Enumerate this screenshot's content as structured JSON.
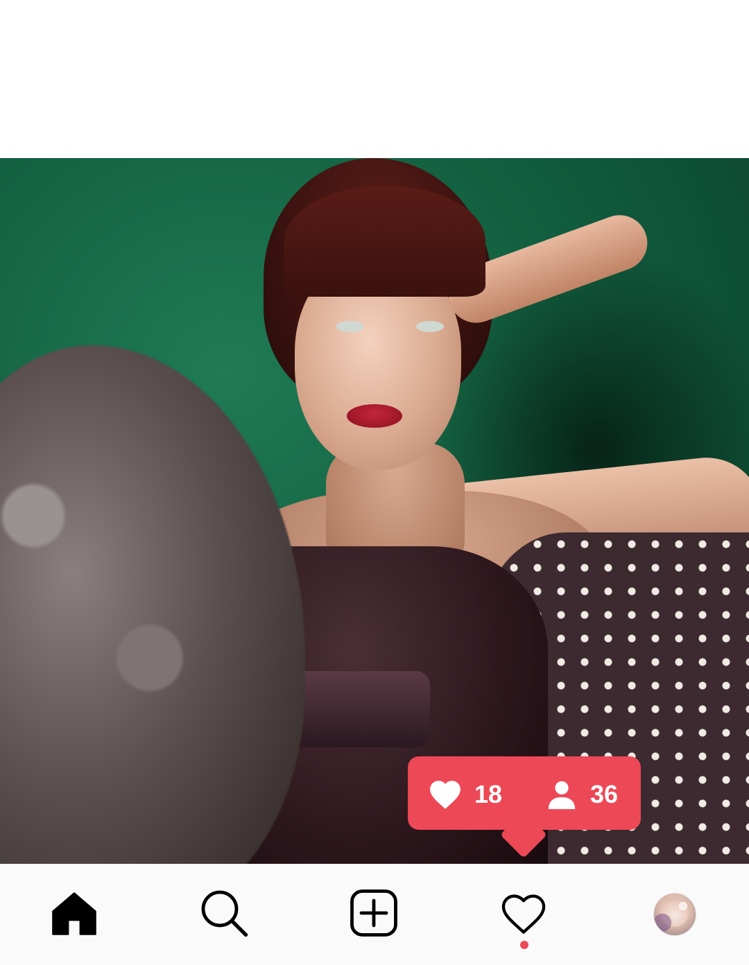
{
  "notification": {
    "likes_count": "18",
    "follows_count": "36",
    "color": "#ed4856"
  },
  "nav": {
    "items": [
      {
        "icon": "home-icon",
        "active": true
      },
      {
        "icon": "search-icon",
        "active": false
      },
      {
        "icon": "add-post-icon",
        "active": false
      },
      {
        "icon": "heart-icon",
        "active": false,
        "has_notification_dot": true
      },
      {
        "icon": "profile-avatar",
        "active": false
      }
    ]
  },
  "colors": {
    "nav_background": "#fafafa",
    "active_icon": "#000000"
  }
}
